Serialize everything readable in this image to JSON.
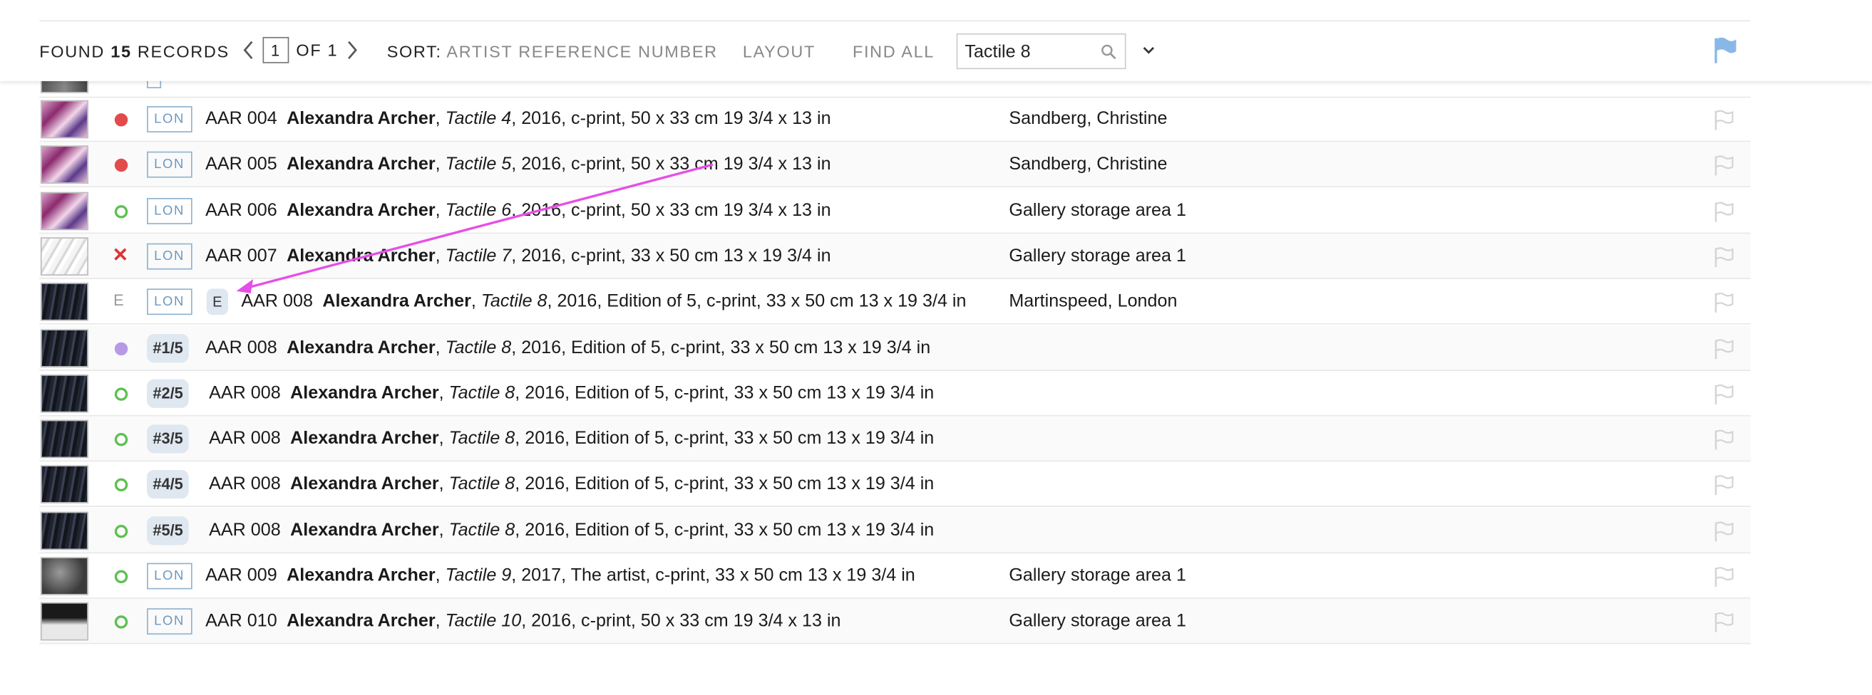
{
  "toolbar": {
    "found_prefix": "FOUND",
    "found_count": "15",
    "found_suffix": "RECORDS",
    "page_current": "1",
    "page_of": "OF 1",
    "sort_label": "SORT:",
    "sort_value": "ARTIST REFERENCE NUMBER",
    "layout_label": "LAYOUT",
    "find_all_label": "FIND ALL",
    "search_value": "Tactile 8",
    "flag_color": "#8ab8e6"
  },
  "rows": [
    {
      "status": "red",
      "tag": "LON",
      "ref": "AAR 004",
      "artist": "Alexandra Archer",
      "title": "Tactile 4",
      "details": ", 2016, c-print, 50 x 33 cm 19 3/4 x 13 in",
      "location": "Sandberg, Christine",
      "thumb": "pink"
    },
    {
      "status": "red",
      "tag": "LON",
      "ref": "AAR 005",
      "artist": "Alexandra Archer",
      "title": "Tactile 5",
      "details": ", 2016, c-print, 50 x 33 cm 19 3/4 x 13 in",
      "location": "Sandberg, Christine",
      "thumb": "pink"
    },
    {
      "status": "ring",
      "tag": "LON",
      "ref": "AAR 006",
      "artist": "Alexandra Archer",
      "title": "Tactile 6",
      "details": ", 2016, c-print, 50 x 33 cm 19 3/4 x 13 in",
      "location": "Gallery storage area 1",
      "thumb": "pink"
    },
    {
      "status": "x",
      "tag": "LON",
      "ref": "AAR 007",
      "artist": "Alexandra Archer",
      "title": "Tactile 7",
      "details": ", 2016, c-print, 33 x 50 cm 13 x 19 3/4 in",
      "location": "Gallery storage area 1",
      "thumb": "white"
    },
    {
      "status": "E",
      "tag": "LON",
      "badge": "E",
      "ref": "AAR 008",
      "artist": "Alexandra Archer",
      "title": "Tactile 8",
      "details": ", 2016, Edition of 5, c-print, 33 x 50 cm 13 x 19 3/4 in",
      "location": "Martinspeed, London",
      "thumb": "dark"
    },
    {
      "status": "purple",
      "tag": "#1/5",
      "ref": "AAR 008",
      "artist": "Alexandra Archer",
      "title": "Tactile 8",
      "details": ", 2016, Edition of 5, c-print, 33 x 50 cm 13 x 19 3/4 in",
      "location": "",
      "thumb": "dark"
    },
    {
      "status": "ring",
      "tag": "#2/5",
      "ref": "AAR 008",
      "artist": "Alexandra Archer",
      "title": "Tactile 8",
      "details": ", 2016, Edition of 5, c-print, 33 x 50 cm 13 x 19 3/4 in",
      "location": "",
      "thumb": "dark"
    },
    {
      "status": "ring",
      "tag": "#3/5",
      "ref": "AAR 008",
      "artist": "Alexandra Archer",
      "title": "Tactile 8",
      "details": ", 2016, Edition of 5, c-print, 33 x 50 cm 13 x 19 3/4 in",
      "location": "",
      "thumb": "dark"
    },
    {
      "status": "ring",
      "tag": "#4/5",
      "ref": "AAR 008",
      "artist": "Alexandra Archer",
      "title": "Tactile 8",
      "details": ", 2016, Edition of 5, c-print, 33 x 50 cm 13 x 19 3/4 in",
      "location": "",
      "thumb": "dark"
    },
    {
      "status": "ring",
      "tag": "#5/5",
      "ref": "AAR 008",
      "artist": "Alexandra Archer",
      "title": "Tactile 8",
      "details": ", 2016, Edition of 5, c-print, 33 x 50 cm 13 x 19 3/4 in",
      "location": "",
      "thumb": "dark"
    },
    {
      "status": "ring",
      "tag": "LON",
      "ref": "AAR 009",
      "artist": "Alexandra Archer",
      "title": "Tactile 9",
      "details": ", 2017, The artist, c-print, 33 x 50 cm 13 x 19 3/4 in",
      "location": "Gallery storage area 1",
      "thumb": "grey"
    },
    {
      "status": "ring",
      "tag": "LON",
      "ref": "AAR 010",
      "artist": "Alexandra Archer",
      "title": "Tactile 10",
      "details": ", 2016, c-print, 50 x 33 cm 19 3/4 x 13 in",
      "location": "Gallery storage area 1",
      "thumb": "drip"
    }
  ],
  "annotation_color": "#e64fe6"
}
